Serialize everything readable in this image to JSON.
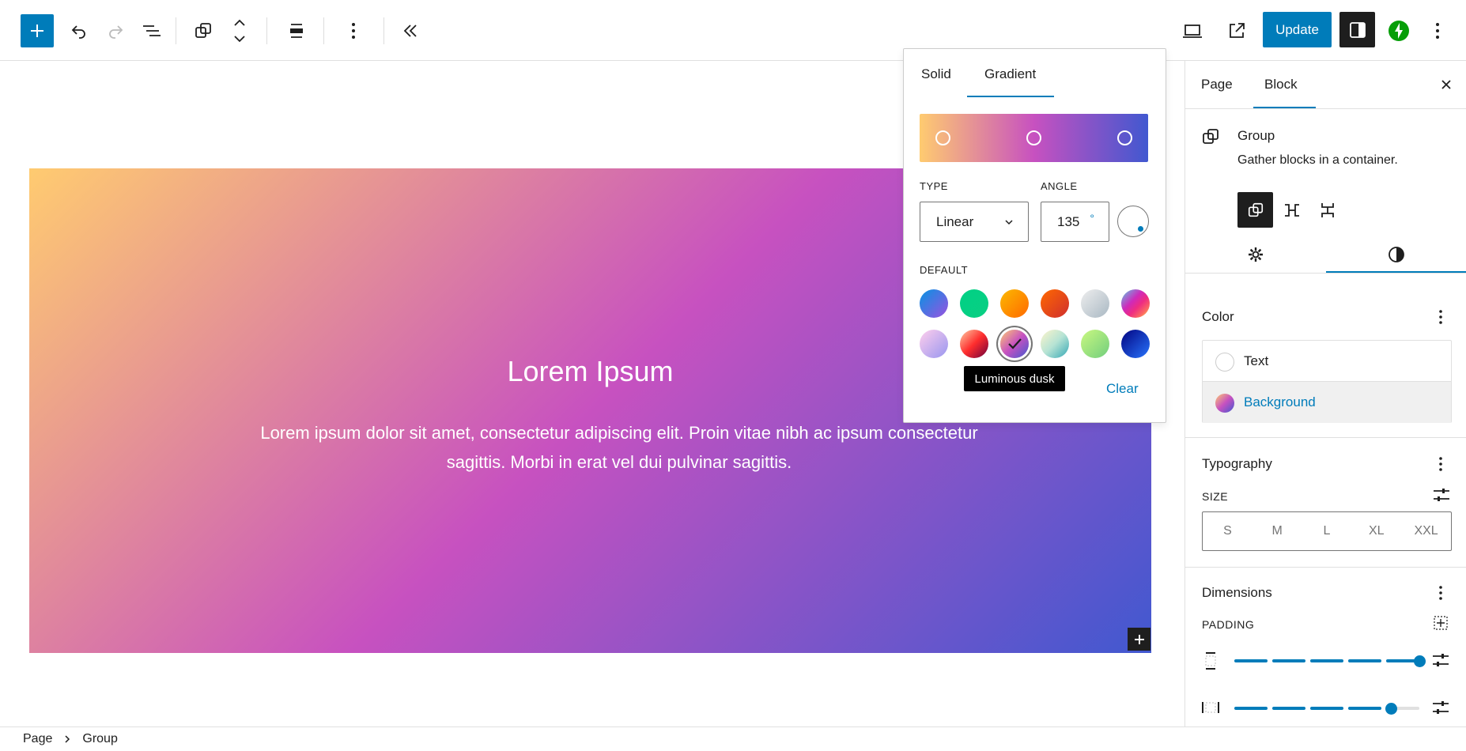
{
  "toolbar": {
    "update_label": "Update",
    "icons": [
      "plus-icon",
      "undo-icon",
      "redo-icon",
      "list-view-icon",
      "group-icon",
      "move-arrows-icon",
      "align-icon",
      "more-vertical-icon",
      "collapse-icon",
      "desktop-preview-icon",
      "external-link-icon",
      "settings-icon",
      "jetpack-icon",
      "options-icon"
    ]
  },
  "canvas": {
    "title": "Lorem Ipsum",
    "text": "Lorem ipsum dolor sit amet, consectetur adipiscing elit. Proin vitae nibh ac ipsum consectetur sagittis. Morbi in erat vel dui pulvinar sagittis.",
    "gradient": [
      "#ffcb70",
      "#c751c0",
      "#4158d0"
    ]
  },
  "footer": {
    "crumb_page": "Page",
    "crumb_group": "Group"
  },
  "popover": {
    "tab_solid": "Solid",
    "tab_gradient": "Gradient",
    "type_label": "TYPE",
    "type_value": "Linear",
    "angle_label": "ANGLE",
    "angle_value": "135",
    "angle_unit": "°",
    "default_label": "DEFAULT",
    "tooltip": "Luminous dusk",
    "clear_label": "Clear",
    "swatches": [
      {
        "name": "vivid-cyan-blue-to-vivid-purple",
        "colors": [
          "#0693e3",
          "#9b51e0"
        ]
      },
      {
        "name": "light-green-cyan-to-vivid-green-cyan",
        "colors": [
          "#00d084",
          "#0acf83"
        ]
      },
      {
        "name": "luminous-vivid-amber-to-luminous-vivid-orange",
        "colors": [
          "#fcb900",
          "#ff6900"
        ]
      },
      {
        "name": "luminous-vivid-orange-to-vivid-red",
        "colors": [
          "#ff6900",
          "#cf2e2e"
        ]
      },
      {
        "name": "very-light-gray-to-cyan-bluish-gray",
        "colors": [
          "#eeeeee",
          "#a9b8c3"
        ]
      },
      {
        "name": "cool-to-warm-spectrum",
        "colors": [
          "#4aeadc",
          "#9778d1",
          "#cf2aba",
          "#ee2c82",
          "#fb6962",
          "#fef84c"
        ]
      },
      {
        "name": "blush-light-purple",
        "colors": [
          "#ffceec",
          "#9896f0"
        ]
      },
      {
        "name": "blush-bordeaux",
        "colors": [
          "#fecda5",
          "#fe2d2d",
          "#6b003e"
        ]
      },
      {
        "name": "luminous-dusk",
        "colors": [
          "#ffcb70",
          "#c751c0",
          "#4158d0"
        ]
      },
      {
        "name": "pale-ocean",
        "colors": [
          "#fff5cb",
          "#b6e3d4",
          "#33a7b5"
        ]
      },
      {
        "name": "electric-grass",
        "colors": [
          "#caf880",
          "#71ce7e"
        ]
      },
      {
        "name": "midnight",
        "colors": [
          "#020381",
          "#2874fc"
        ]
      }
    ]
  },
  "sidebar": {
    "tab_page": "Page",
    "tab_block": "Block",
    "block_title": "Group",
    "block_desc": "Gather blocks in a container.",
    "color_title": "Color",
    "color_text": "Text",
    "color_background": "Background",
    "typography_title": "Typography",
    "size_label": "SIZE",
    "sizes": [
      "S",
      "M",
      "L",
      "XL",
      "XXL"
    ],
    "dimensions_title": "Dimensions",
    "padding_label": "PADDING",
    "padding_top_value": 1.0,
    "padding_side_value": 0.85
  },
  "colors": {
    "accent": "#007cba",
    "dark": "#1e1e1e",
    "jetpack": "#069e08"
  }
}
